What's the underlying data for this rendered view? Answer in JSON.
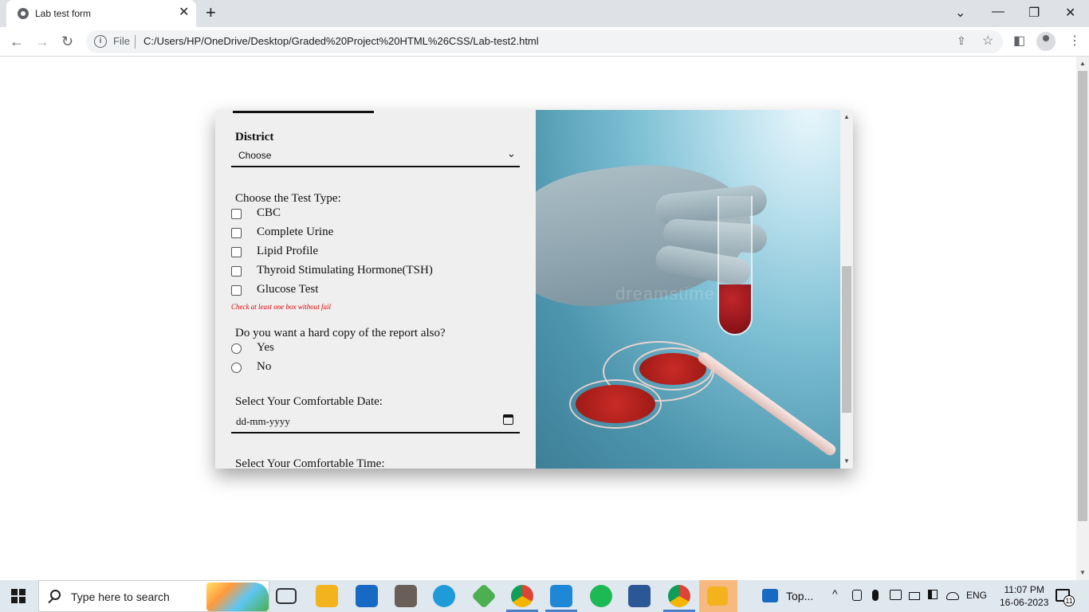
{
  "browser": {
    "tab_title": "Lab test form",
    "tab_close": "✕",
    "new_tab": "+",
    "window_controls": {
      "dropdown": "⌄",
      "minimize": "—",
      "restore": "❐",
      "close": "✕"
    },
    "nav": {
      "back": "←",
      "forward": "→",
      "reload": "↻"
    },
    "address": {
      "info_glyph": "i",
      "scheme_label": "File",
      "url": "C:/Users/HP/OneDrive/Desktop/Graded%20Project%20HTML%26CSS/Lab-test2.html",
      "share_glyph": "⇪",
      "star_glyph": "☆"
    },
    "side_panel_glyph": "◧",
    "menu_glyph": "⋮"
  },
  "form": {
    "district_label": "District",
    "district_select": {
      "selected": "Choose",
      "chevron": "⌄"
    },
    "test_type_question": "Choose the Test Type:",
    "test_types": [
      {
        "label": "CBC",
        "checked": false
      },
      {
        "label": "Complete Urine",
        "checked": false
      },
      {
        "label": "Lipid Profile",
        "checked": false
      },
      {
        "label": "Thyroid Stimulating Hormone(TSH)",
        "checked": false
      },
      {
        "label": "Glucose Test",
        "checked": false
      }
    ],
    "validation_message": "Check at least one box without fail",
    "hard_copy_question": "Do you want a hard copy of the report also?",
    "hard_copy_options": [
      {
        "label": "Yes",
        "selected": false
      },
      {
        "label": "No",
        "selected": false
      }
    ],
    "date_question": "Select Your Comfortable Date:",
    "date_placeholder": "dd-mm-yyyy",
    "time_question": "Select Your Comfortable Time:"
  },
  "image": {
    "watermark": "dreamstime"
  },
  "scrollbar": {
    "up": "▲",
    "down": "▼"
  },
  "taskbar": {
    "search_placeholder": "Type here to search",
    "running_app_label": "Top...",
    "language": "ENG",
    "time": "11:07 PM",
    "date": "16-06-2023",
    "notification_count": "11"
  },
  "colors": {
    "warning": "#e00000",
    "card_bg": "#efefef",
    "chrome_tabbar": "#dee1e6",
    "taskbar_bg": "#dfe7ef"
  }
}
